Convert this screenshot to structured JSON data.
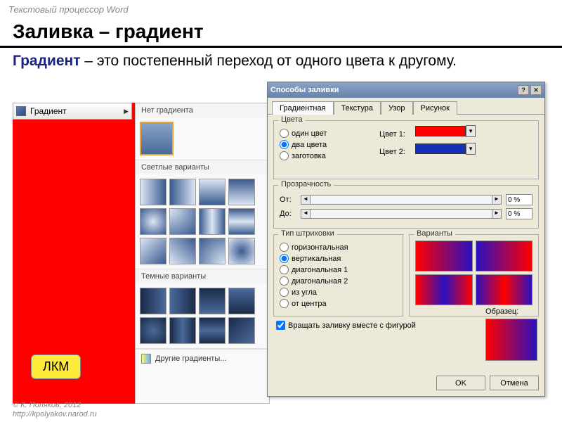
{
  "page_header": "Текстовый процессор Word",
  "main_heading": "Заливка – градиент",
  "body_text_strong": "Градиент",
  "body_text_rest": " – это постепенный переход от одного цвета к другому.",
  "lmb_badge": "ЛКМ",
  "gradient_menu_label": "Градиент",
  "gallery": {
    "no_gradient": "Нет градиента",
    "light": "Светлые варианты",
    "dark": "Темные варианты",
    "more": "Другие градиенты..."
  },
  "dialog": {
    "title": "Способы заливки",
    "tabs": {
      "gradient": "Градиентная",
      "texture": "Текстура",
      "pattern": "Узор",
      "picture": "Рисунок"
    },
    "colors_group": "Цвета",
    "radio_one": "один цвет",
    "radio_two": "два цвета",
    "radio_preset": "заготовка",
    "color1_label": "Цвет 1:",
    "color2_label": "Цвет 2:",
    "color1": "#ff0000",
    "color2": "#1530b8",
    "transparency_group": "Прозрачность",
    "from_label": "От:",
    "to_label": "До:",
    "from_value": "0 %",
    "to_value": "0 %",
    "hatch_group": "Тип штриховки",
    "hatch": {
      "horizontal": "горизонтальная",
      "vertical": "вертикальная",
      "diag1": "диагональная 1",
      "diag2": "диагональная 2",
      "corner": "из угла",
      "center": "от центра"
    },
    "variants_group": "Варианты",
    "sample_label": "Образец:",
    "rotate_label": "Вращать заливку вместе с фигурой",
    "ok": "OK",
    "cancel": "Отмена"
  },
  "copyright": {
    "line1": "© К. Поляков, 2012",
    "line2": "http://kpolyakov.narod.ru"
  }
}
